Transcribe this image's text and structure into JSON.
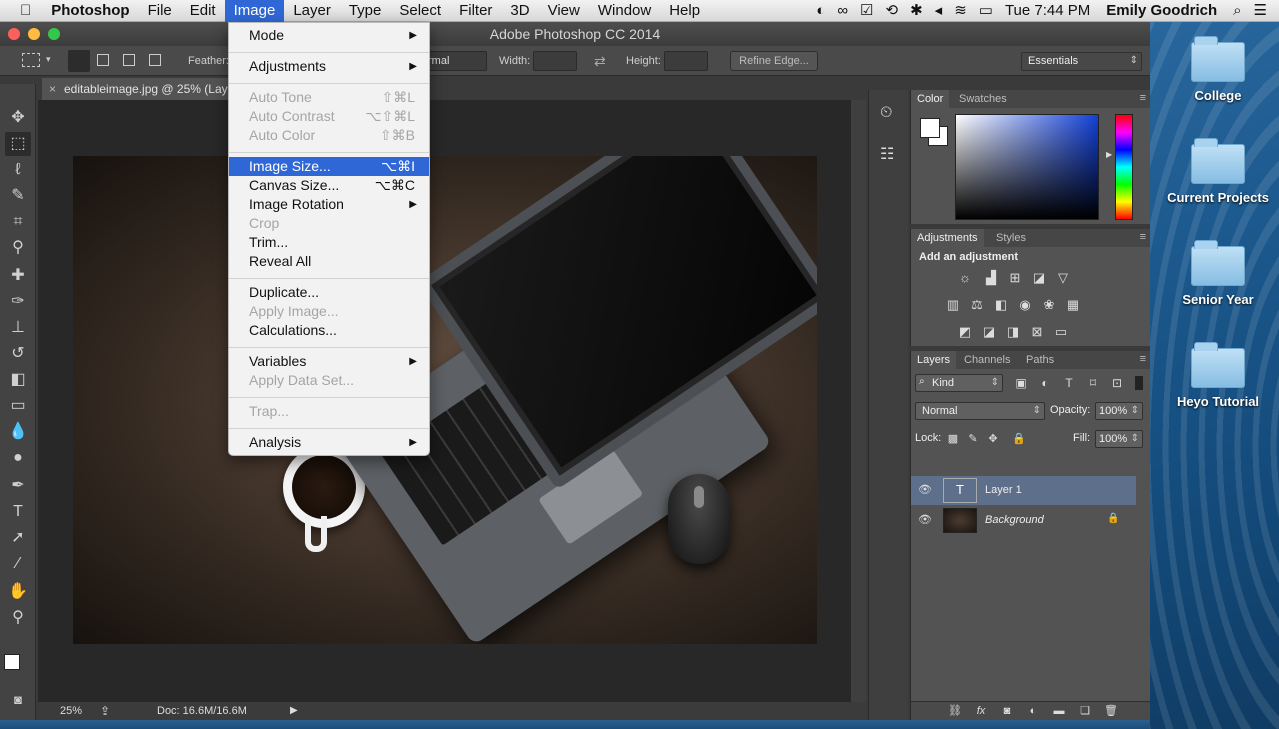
{
  "menubar": {
    "app_name": "Photoshop",
    "menus": [
      "File",
      "Edit",
      "Image",
      "Layer",
      "Type",
      "Select",
      "Filter",
      "3D",
      "View",
      "Window",
      "Help"
    ],
    "active_menu": "Image",
    "clock": "Tue 7:44 PM",
    "user": "Emily Goodrich"
  },
  "window": {
    "title": "Adobe Photoshop CC 2014"
  },
  "options": {
    "feather_label": "Feather:",
    "style_value": "rmal",
    "width_label": "Width:",
    "height_label": "Height:",
    "refine_edge": "Refine Edge...",
    "workspace": "Essentials"
  },
  "document": {
    "tab_title": "editableimage.jpg @ 25% (Lay",
    "zoom": "25%",
    "doc_size": "Doc: 16.6M/16.6M"
  },
  "image_menu": {
    "items": [
      {
        "label": "Mode",
        "shortcut": "",
        "submenu": true,
        "disabled": false
      },
      {
        "label": "Adjustments",
        "shortcut": "",
        "submenu": true,
        "disabled": false
      },
      {
        "label": "Auto Tone",
        "shortcut": "⇧⌘L",
        "submenu": false,
        "disabled": true
      },
      {
        "label": "Auto Contrast",
        "shortcut": "⌥⇧⌘L",
        "submenu": false,
        "disabled": true
      },
      {
        "label": "Auto Color",
        "shortcut": "⇧⌘B",
        "submenu": false,
        "disabled": true
      },
      {
        "label": "Image Size...",
        "shortcut": "⌥⌘I",
        "submenu": false,
        "disabled": false
      },
      {
        "label": "Canvas Size...",
        "shortcut": "⌥⌘C",
        "submenu": false,
        "disabled": false
      },
      {
        "label": "Image Rotation",
        "shortcut": "",
        "submenu": true,
        "disabled": false
      },
      {
        "label": "Crop",
        "shortcut": "",
        "submenu": false,
        "disabled": true
      },
      {
        "label": "Trim...",
        "shortcut": "",
        "submenu": false,
        "disabled": false
      },
      {
        "label": "Reveal All",
        "shortcut": "",
        "submenu": false,
        "disabled": false
      },
      {
        "label": "Duplicate...",
        "shortcut": "",
        "submenu": false,
        "disabled": false
      },
      {
        "label": "Apply Image...",
        "shortcut": "",
        "submenu": false,
        "disabled": true
      },
      {
        "label": "Calculations...",
        "shortcut": "",
        "submenu": false,
        "disabled": false
      },
      {
        "label": "Variables",
        "shortcut": "",
        "submenu": true,
        "disabled": false
      },
      {
        "label": "Apply Data Set...",
        "shortcut": "",
        "submenu": false,
        "disabled": true
      },
      {
        "label": "Trap...",
        "shortcut": "",
        "submenu": false,
        "disabled": true
      },
      {
        "label": "Analysis",
        "shortcut": "",
        "submenu": true,
        "disabled": false
      }
    ],
    "highlighted": "Image Size..."
  },
  "panels": {
    "color_tabs": [
      "Color",
      "Swatches"
    ],
    "adjustments_tabs": [
      "Adjustments",
      "Styles"
    ],
    "add_adjustment": "Add an adjustment",
    "layers_tabs": [
      "Layers",
      "Channels",
      "Paths"
    ],
    "kind_filter": "Kind",
    "blend_mode": "Normal",
    "opacity_label": "Opacity:",
    "opacity_value": "100%",
    "lock_label": "Lock:",
    "fill_label": "Fill:",
    "fill_value": "100%",
    "layers": [
      {
        "name": "Layer 1",
        "type": "text",
        "selected": true
      },
      {
        "name": "Background",
        "type": "image",
        "selected": false,
        "locked": true
      }
    ]
  },
  "desktop_folders": [
    "College",
    "Current Projects",
    "Senior Year",
    "Heyo Tutorial"
  ]
}
